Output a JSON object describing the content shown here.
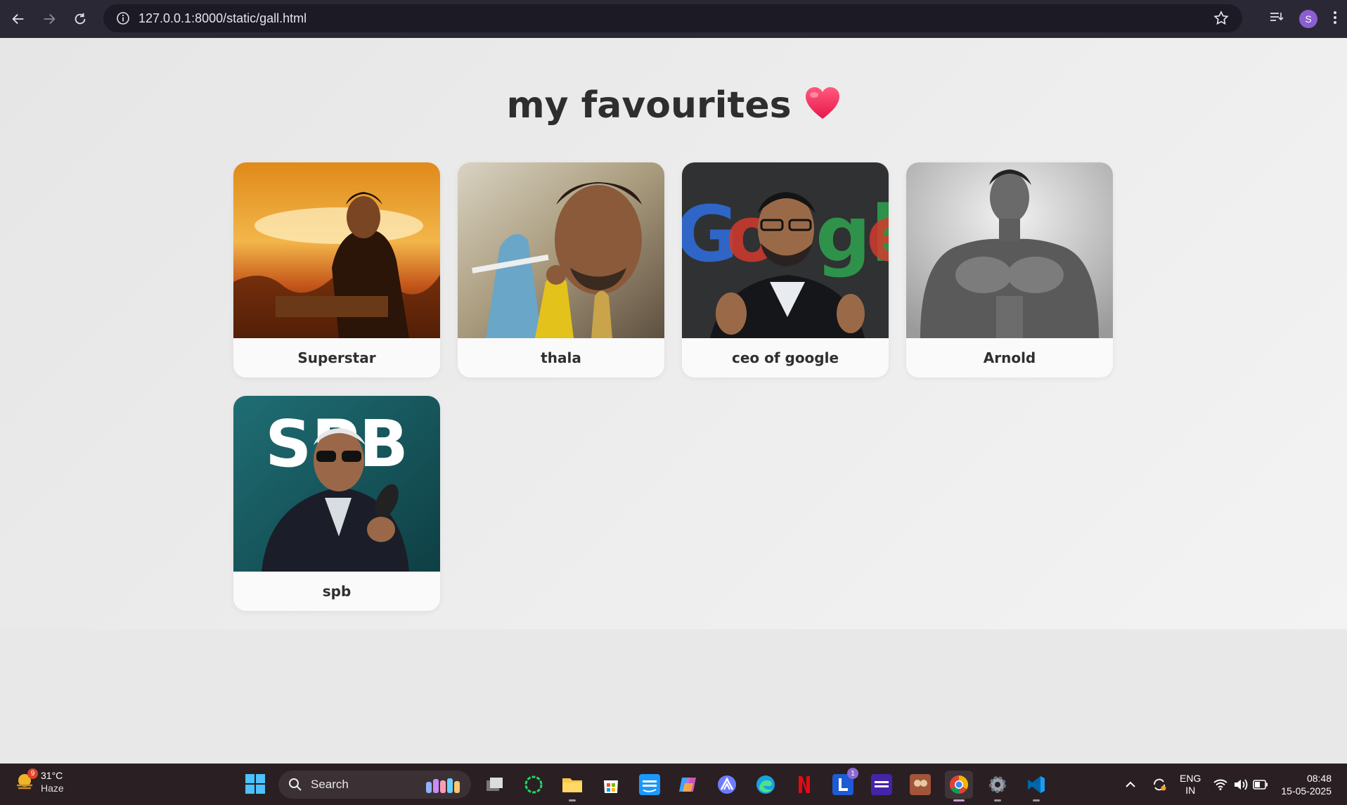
{
  "browser": {
    "url": "127.0.0.1:8000/static/gall.html",
    "avatar_letter": "S",
    "icons": [
      "back-icon",
      "forward-icon",
      "reload-icon",
      "site-info-icon",
      "bookmark-star-icon",
      "tab-search-icon",
      "menu-kebab-icon"
    ]
  },
  "page": {
    "title": "my favourites",
    "cards": [
      {
        "caption": "Superstar"
      },
      {
        "caption": "thala"
      },
      {
        "caption": "ceo of google"
      },
      {
        "caption": "Arnold"
      },
      {
        "caption": "spb"
      }
    ],
    "spb_logo_text": "SPB"
  },
  "taskbar": {
    "weather": {
      "temp": "31°C",
      "condition": "Haze",
      "badge": "9"
    },
    "search_label": "Search",
    "apps": [
      "task-view",
      "spotify-like",
      "file-explorer",
      "microsoft-store",
      "prime-video",
      "copilot",
      "proton",
      "edge",
      "netflix",
      "l-app",
      "amazon-music",
      "photo-app",
      "chrome",
      "settings",
      "vscode"
    ],
    "l_app_badge": "1",
    "lang_top": "ENG",
    "lang_bottom": "IN",
    "time": "08:48",
    "date": "15-05-2025"
  },
  "colors": {
    "chrome_bg": "#2b2836",
    "taskbar_bg": "#2a1f22",
    "title": "#2e2e2e",
    "heart": "#ff3b6b"
  }
}
